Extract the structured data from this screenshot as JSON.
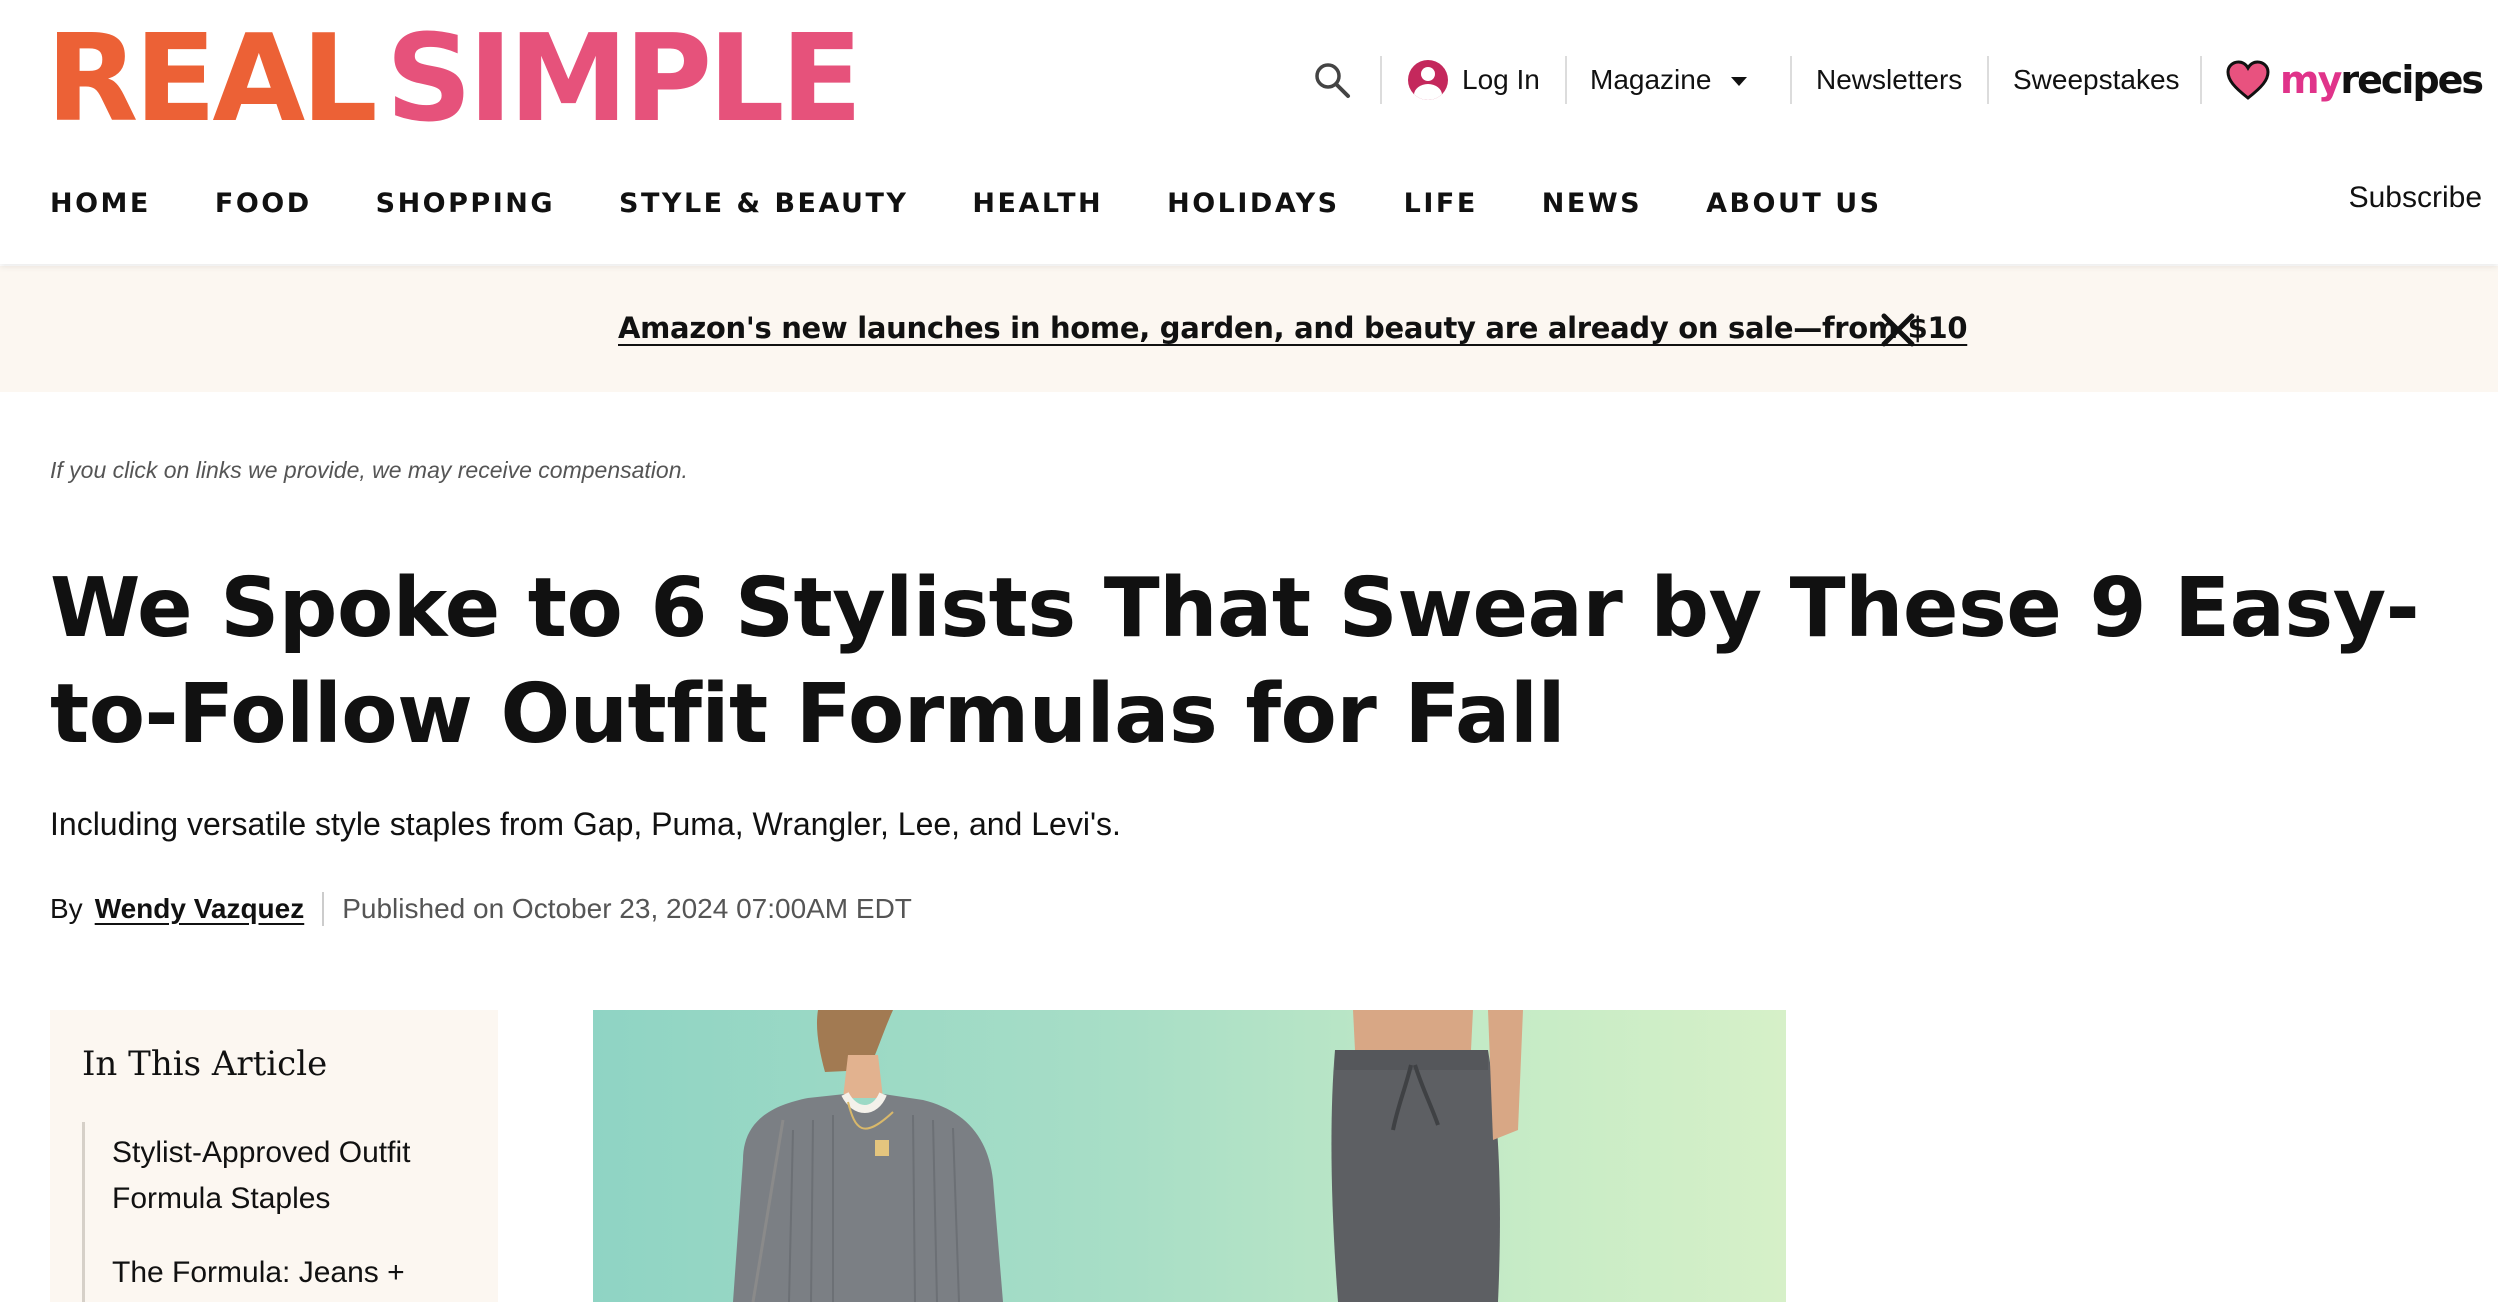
{
  "brand": {
    "logo_part1": "REAL",
    "logo_part2": "SIMPLE",
    "color1": "#ec6136",
    "color2": "#e6527b"
  },
  "utility": {
    "search_icon": "search-icon",
    "login_label": "Log In",
    "magazine_label": "Magazine",
    "newsletters_label": "Newsletters",
    "sweepstakes_label": "Sweepstakes",
    "partner_logo_my": "my",
    "partner_logo_recipes": "recipes"
  },
  "nav": {
    "items": [
      "HOME",
      "FOOD",
      "SHOPPING",
      "STYLE & BEAUTY",
      "HEALTH",
      "HOLIDAYS",
      "LIFE",
      "NEWS",
      "ABOUT US"
    ],
    "subscribe_label": "Subscribe"
  },
  "promo": {
    "text": "Amazon's new launches in home, garden, and beauty are already on sale—from $10",
    "close_icon": "close-icon"
  },
  "article": {
    "disclaimer": "If you click on links we provide, we may receive compensation.",
    "headline": "We Spoke to 6 Stylists That Swear by These 9 Easy-to-Follow Outfit Formulas for Fall",
    "dek": "Including versatile style staples from Gap, Puma, Wrangler, Lee, and Levi's.",
    "by_label": "By",
    "author": "Wendy Vazquez",
    "published": "Published on October 23, 2024 07:00AM EDT"
  },
  "toc": {
    "title": "In This Article",
    "items": [
      "Stylist-Approved Outfit Formula Staples",
      "The Formula: Jeans + Leather Jacket"
    ]
  }
}
